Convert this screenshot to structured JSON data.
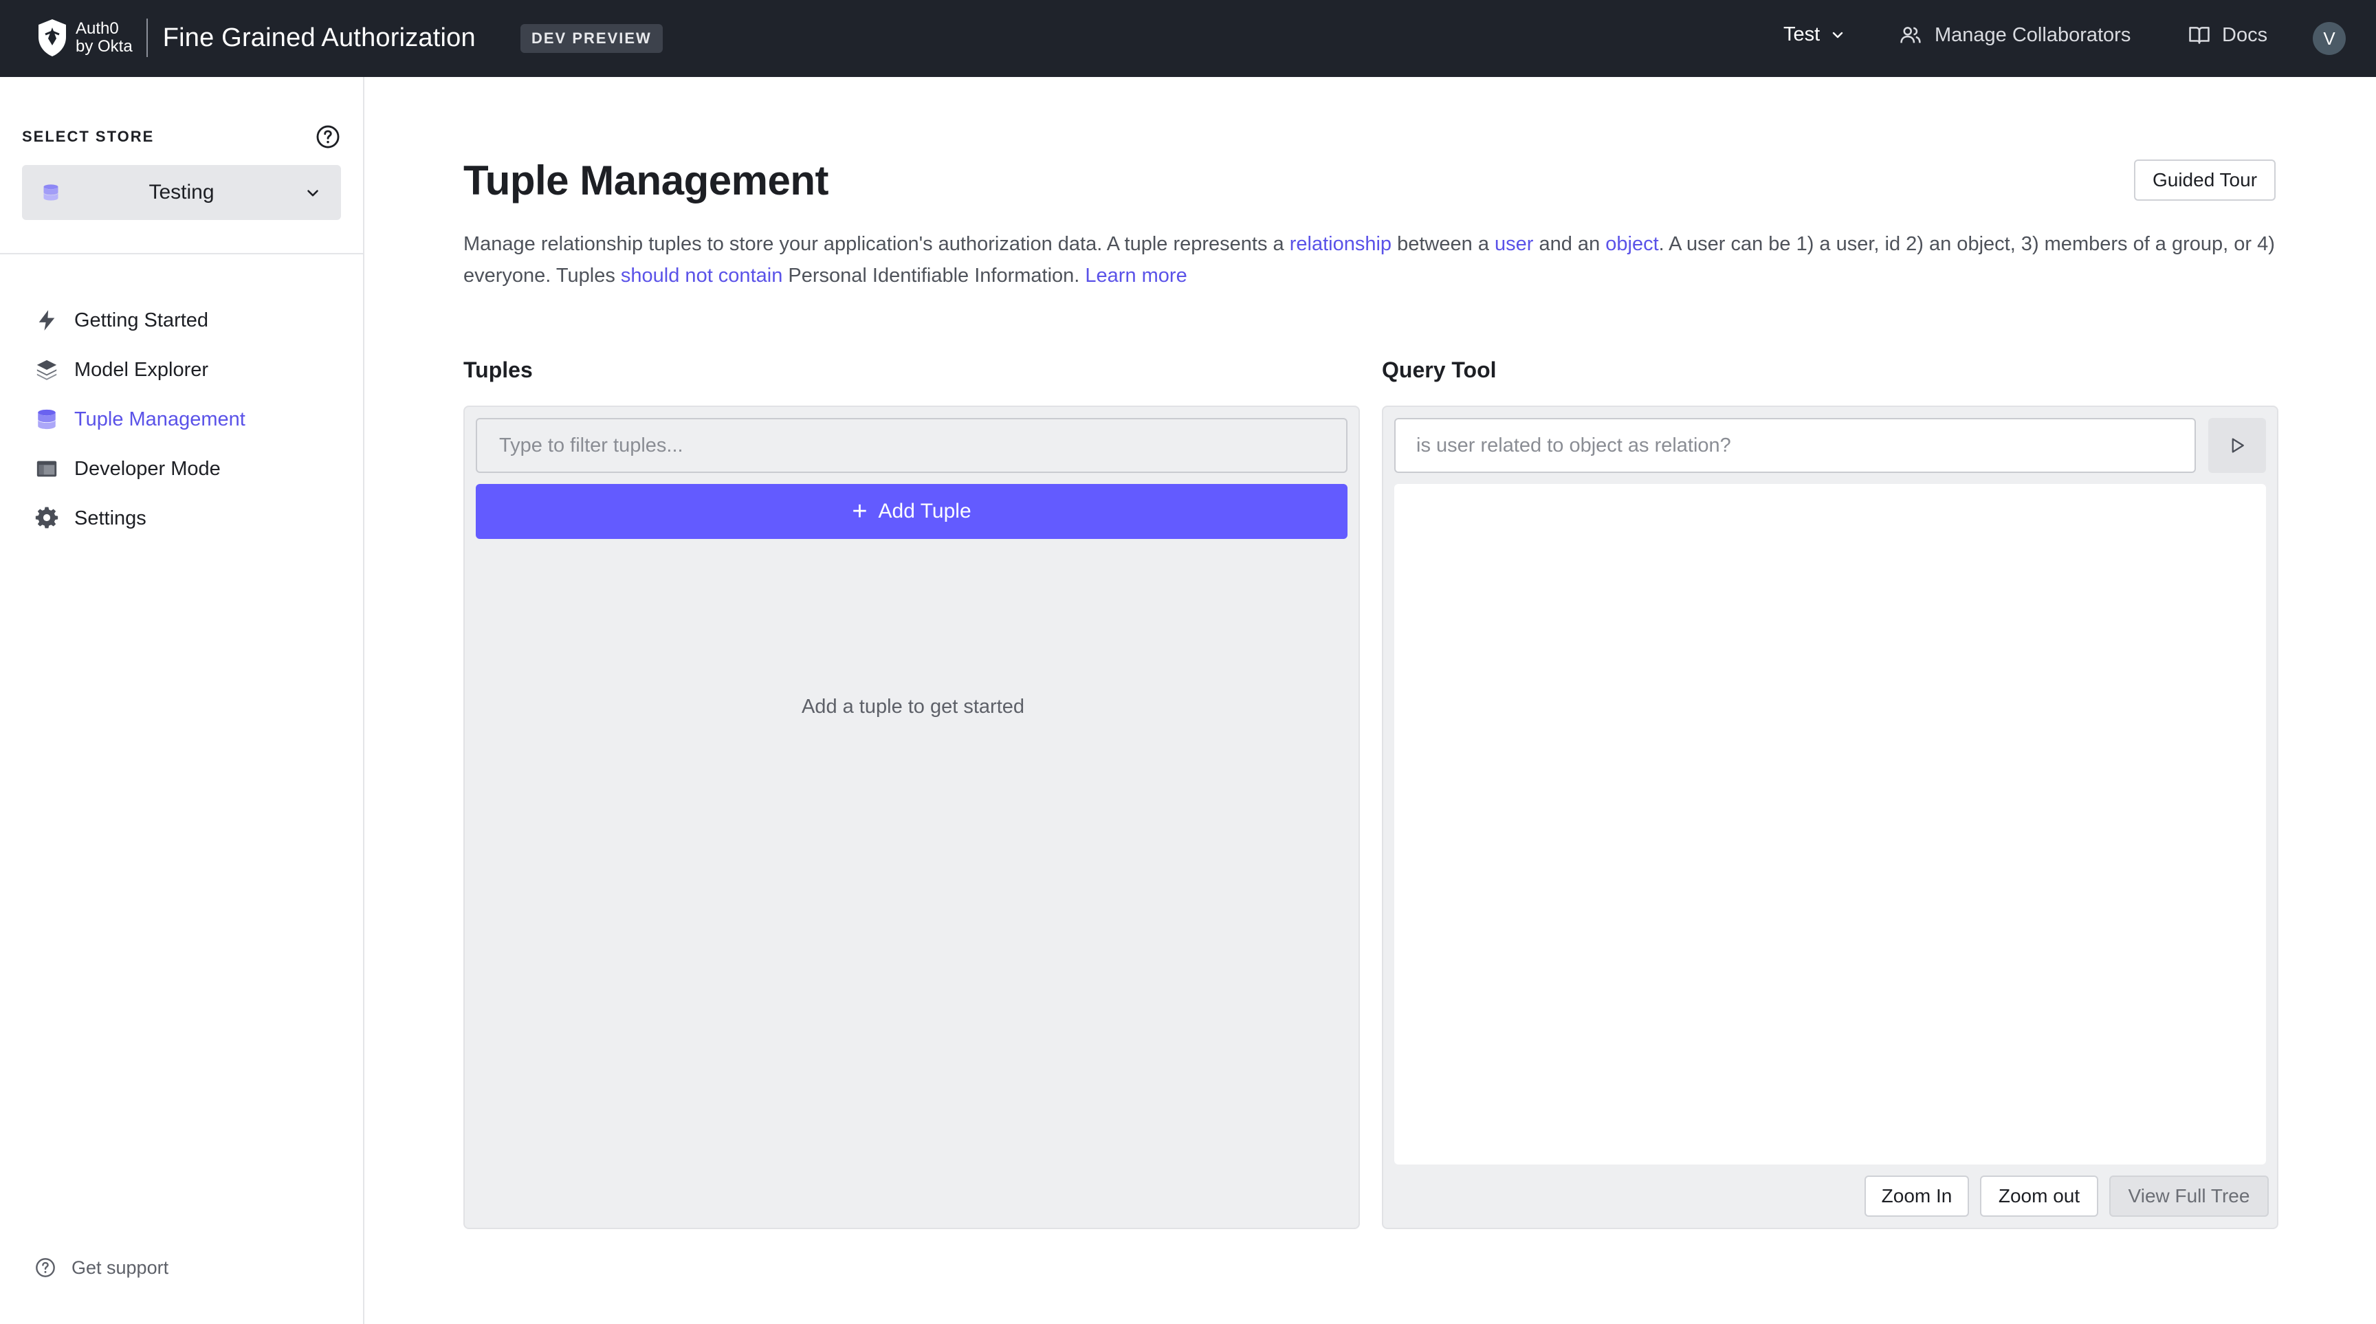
{
  "header": {
    "logo_line1": "Auth0",
    "logo_line2": "by Okta",
    "product_name": "Fine Grained Authorization",
    "badge": "DEV PREVIEW",
    "tenant": "Test",
    "collaborators_label": "Manage Collaborators",
    "docs_label": "Docs",
    "avatar_initial": "V"
  },
  "sidebar": {
    "store_label": "SELECT STORE",
    "store_name": "Testing",
    "items": [
      {
        "label": "Getting Started",
        "icon": "lightning-icon"
      },
      {
        "label": "Model Explorer",
        "icon": "layers-icon"
      },
      {
        "label": "Tuple Management",
        "icon": "database-icon",
        "active": true
      },
      {
        "label": "Developer Mode",
        "icon": "window-icon"
      },
      {
        "label": "Settings",
        "icon": "gear-icon"
      }
    ],
    "support_label": "Get support"
  },
  "main": {
    "title": "Tuple Management",
    "tour_button": "Guided Tour",
    "desc": {
      "p1": "Manage relationship tuples to store your application's authorization data. A tuple represents a ",
      "link_relationship": "relationship",
      "p2": " between a ",
      "link_user": "user",
      "p3": " and an ",
      "link_object": "object",
      "p4": ". A user can be 1) a user, id 2) an object, 3) members of a group, or 4) everyone. Tuples ",
      "link_should_not": "should not contain",
      "p5": " Personal Identifiable Information. ",
      "link_learn": "Learn more"
    },
    "tuples": {
      "title": "Tuples",
      "filter_placeholder": "Type to filter tuples...",
      "add_button": "Add Tuple",
      "empty_message": "Add a tuple to get started"
    },
    "query": {
      "title": "Query Tool",
      "placeholder": "is user related to object as relation?",
      "zoom_in": "Zoom In",
      "zoom_out": "Zoom out",
      "view_full_tree": "View Full Tree"
    }
  },
  "colors": {
    "topbar": "#1f232b",
    "accent": "#635bff",
    "link": "#5a52e8"
  }
}
